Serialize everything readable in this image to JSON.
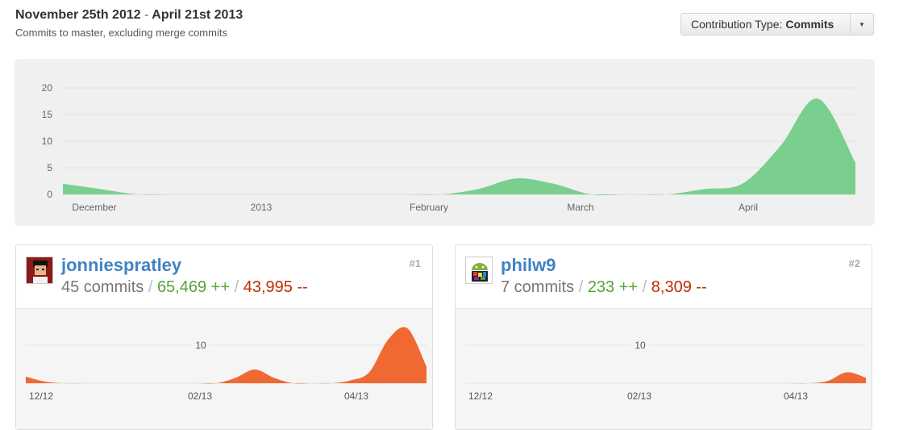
{
  "header": {
    "range_start": "November 25th 2012",
    "range_end": "April 21st 2013",
    "subtitle": "Commits to master, excluding merge commits"
  },
  "contribution_type": {
    "prefix": "Contribution Type:",
    "value": "Commits"
  },
  "colors": {
    "main_area": "#7acf8e",
    "spark_area": "#f06832",
    "link": "#4183c4",
    "additions": "#55a532",
    "deletions": "#bd2c00"
  },
  "chart_data": [
    {
      "type": "area",
      "x_ticks": [
        "December",
        "2013",
        "February",
        "March",
        "April"
      ],
      "y_ticks": [
        0,
        5,
        10,
        15,
        20
      ],
      "ylim": [
        0,
        22
      ],
      "x": [
        "2012-11-25",
        "2012-12-02",
        "2012-12-09",
        "2012-12-16",
        "2012-12-23",
        "2012-12-30",
        "2013-01-06",
        "2013-01-13",
        "2013-01-20",
        "2013-01-27",
        "2013-02-03",
        "2013-02-10",
        "2013-02-17",
        "2013-02-24",
        "2013-03-03",
        "2013-03-10",
        "2013-03-17",
        "2013-03-24",
        "2013-03-31",
        "2013-04-07",
        "2013-04-14",
        "2013-04-21"
      ],
      "values": [
        2,
        1,
        0,
        0,
        0,
        0,
        0,
        0,
        0,
        0,
        0,
        1,
        3,
        2,
        0,
        0,
        0,
        1,
        2,
        9,
        18,
        6
      ],
      "grid": true
    },
    {
      "type": "area",
      "x_ticks": [
        "12/12",
        "02/13",
        "04/13"
      ],
      "y_ticks": [
        10
      ],
      "values": [
        1.2,
        0.3,
        0,
        0,
        0,
        0,
        0,
        0,
        0,
        0,
        0,
        1,
        2.5,
        1,
        0,
        0,
        0,
        0.5,
        2,
        8,
        10,
        3
      ]
    },
    {
      "type": "area",
      "x_ticks": [
        "12/12",
        "02/13",
        "04/13"
      ],
      "y_ticks": [
        10
      ],
      "values": [
        0,
        0,
        0,
        0,
        0,
        0,
        0,
        0,
        0,
        0,
        0,
        0,
        0,
        0,
        0,
        0,
        0,
        0,
        0,
        0.4,
        2,
        1
      ]
    }
  ],
  "contributors": [
    {
      "name": "jonniespratley",
      "rank": "#1",
      "commits": "45 commits",
      "additions": "65,469 ++",
      "deletions": "43,995 --",
      "slash": "/"
    },
    {
      "name": "philw9",
      "rank": "#2",
      "commits": "7 commits",
      "additions": "233 ++",
      "deletions": "8,309 --",
      "slash": "/"
    }
  ]
}
